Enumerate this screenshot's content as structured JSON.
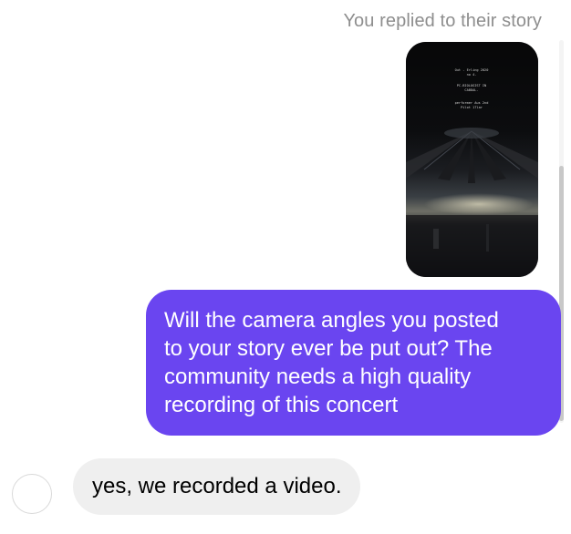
{
  "story_reply": {
    "caption": "You replied to their story",
    "thumbnail_lines": [
      "Out - Erling 2020",
      "no 4.",
      "PC-BIOLOGIST IN",
      "CABDAL.",
      "performer Aus 2nd",
      "Pilot 17lar"
    ]
  },
  "messages": {
    "sent": {
      "text": "Will the camera angles you posted\nto your story ever be put out? The\ncommunity needs a high quality\nrecording of this concert"
    },
    "received": {
      "text": "yes, we recorded a video."
    }
  },
  "colors": {
    "sent_bubble": "#6a45f0",
    "received_bubble": "#efefef",
    "caption_text": "#8e8e8e"
  },
  "icons": {
    "avatar": "empty-circle-avatar"
  }
}
